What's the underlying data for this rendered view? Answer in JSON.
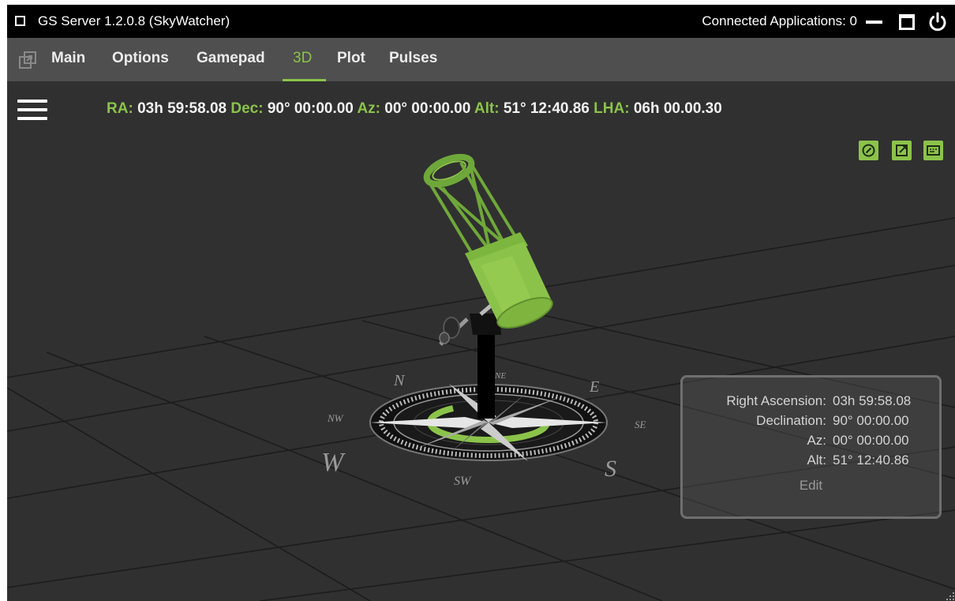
{
  "titlebar": {
    "title": "GS Server 1.2.0.8 (SkyWatcher)",
    "connected": "Connected Applications: 0"
  },
  "menu": {
    "items": [
      {
        "label": "Main"
      },
      {
        "label": "Options"
      },
      {
        "label": "Gamepad"
      },
      {
        "label": "3D",
        "active": true
      },
      {
        "label": "Plot"
      },
      {
        "label": "Pulses"
      }
    ]
  },
  "coords": {
    "ra_label": "RA:",
    "ra": "03h 59:58.08",
    "dec_label": "Dec:",
    "dec": "90° 00:00.00",
    "az_label": "Az:",
    "az": "00° 00:00.00",
    "alt_label": "Alt:",
    "alt": "51° 12:40.86",
    "lha_label": "LHA:",
    "lha": "06h 00.00.30"
  },
  "compass": {
    "n": "N",
    "ne": "NE",
    "e": "E",
    "se": "SE",
    "s": "S",
    "sw": "SW",
    "w": "W",
    "nw": "NW"
  },
  "info": {
    "rows": [
      {
        "label": "Right Ascension:",
        "value": "03h 59:58.08"
      },
      {
        "label": "Declination:",
        "value": "90° 00:00.00"
      },
      {
        "label": "Az:",
        "value": "00° 00:00.00"
      },
      {
        "label": "Alt:",
        "value": "51° 12:40.86"
      }
    ],
    "edit_label": "Edit"
  },
  "icons": {
    "window": "window-icon",
    "minimize": "minimize-icon",
    "maximize": "maximize-icon",
    "power": "power-icon",
    "popout": "popout-icon",
    "hamburger": "hamburger-menu-icon",
    "compass_btn": "compass-icon",
    "open_external": "open-external-icon",
    "display": "display-icon"
  },
  "colors": {
    "accent": "#8bc34a",
    "titlebar": "#000000",
    "menubar": "#4f4f4f",
    "background": "#303030"
  }
}
